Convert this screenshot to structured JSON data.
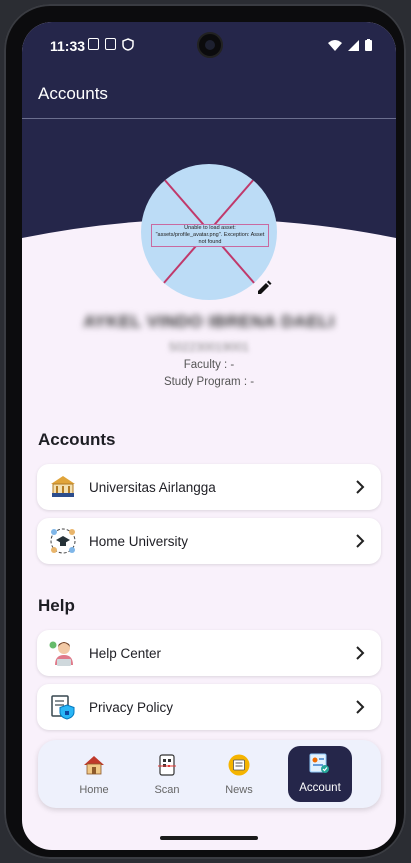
{
  "status_bar": {
    "time": "11:33"
  },
  "app_bar": {
    "title": "Accounts"
  },
  "profile": {
    "avatar_error": "Unable to load asset: \"assets/profile_avatar.png\". Exception: Asset not found",
    "name": "AYKEL VINDO IBRENA DAELI",
    "id_number": "502230019001",
    "faculty": "Faculty : -",
    "study_program": "Study Program : -"
  },
  "sections": {
    "accounts": {
      "title": "Accounts",
      "items": [
        {
          "label": "Universitas Airlangga",
          "icon": "university-icon"
        },
        {
          "label": "Home University",
          "icon": "graduation-network-icon"
        }
      ]
    },
    "help": {
      "title": "Help",
      "items": [
        {
          "label": "Help Center",
          "icon": "support-agent-icon"
        },
        {
          "label": "Privacy Policy",
          "icon": "privacy-shield-icon"
        }
      ]
    }
  },
  "bottom_nav": {
    "items": [
      {
        "label": "Home",
        "icon": "house-icon"
      },
      {
        "label": "Scan",
        "icon": "qr-scan-icon"
      },
      {
        "label": "News",
        "icon": "newspaper-icon"
      },
      {
        "label": "Account",
        "icon": "account-card-icon",
        "active": true
      }
    ]
  },
  "colors": {
    "primary": "#25264a",
    "background": "#f9f1fb",
    "accent": "#bcdcf6"
  }
}
